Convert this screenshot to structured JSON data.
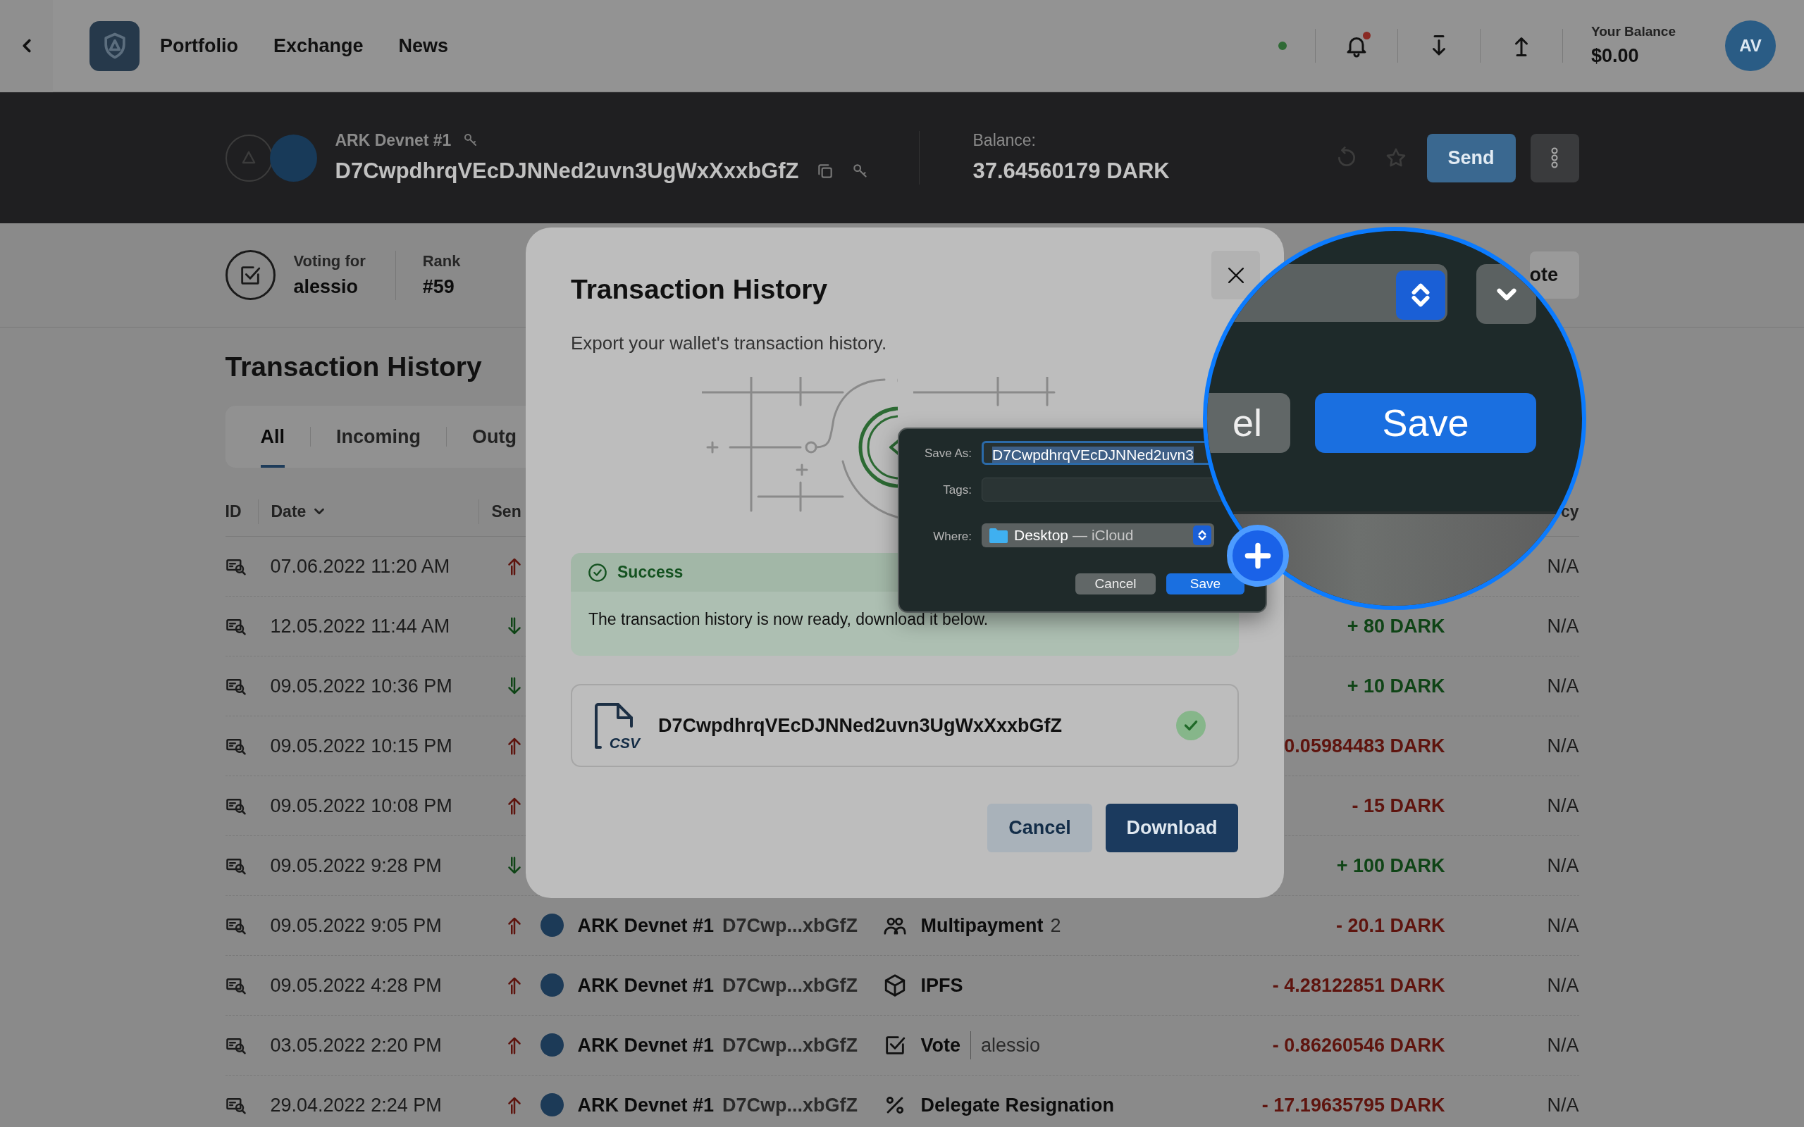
{
  "nav": {
    "links": [
      {
        "label": "Portfolio"
      },
      {
        "label": "Exchange"
      },
      {
        "label": "News"
      }
    ],
    "connected": true,
    "unread_notifications": true,
    "balance_label": "Your Balance",
    "balance": "$0.00",
    "avatar": "AV"
  },
  "wallet": {
    "name": "ARK Devnet #1",
    "address": "D7CwpdhrqVEcDJNNed2uvn3UgWxXxxbGfZ",
    "balance_label": "Balance:",
    "balance": "37.64560179 DARK",
    "send": "Send"
  },
  "voting": {
    "label": "Voting for",
    "delegate": "alessio",
    "rank_label": "Rank",
    "rank": "#59",
    "vote_button": "ote"
  },
  "history": {
    "title": "Transaction History",
    "tabs": [
      {
        "label": "All",
        "selected": true
      },
      {
        "label": "Incoming",
        "selected": false
      },
      {
        "label": "Outg",
        "selected": false
      }
    ],
    "columns": [
      "ID",
      "Date",
      "Sen",
      "cy"
    ],
    "rows": [
      {
        "date": "07.06.2022 11:20 AM",
        "incoming": false,
        "currency": "N/A"
      },
      {
        "date": "12.05.2022 11:44 AM",
        "incoming": true,
        "amount": "+ 80 DARK",
        "currency": "N/A"
      },
      {
        "date": "09.05.2022 10:36 PM",
        "incoming": true,
        "amount": "+ 10 DARK",
        "currency": "N/A"
      },
      {
        "date": "09.05.2022 10:15 PM",
        "incoming": false,
        "amount": "0.05984483 DARK",
        "currency": "N/A"
      },
      {
        "date": "09.05.2022 10:08 PM",
        "incoming": false,
        "amount": "- 15 DARK",
        "currency": "N/A"
      },
      {
        "date": "09.05.2022 9:28 PM",
        "incoming": true,
        "amount": "+ 100 DARK",
        "currency": "N/A"
      },
      {
        "date": "09.05.2022 9:05 PM",
        "incoming": false,
        "sender": "ARK Devnet #1",
        "address": "D7Cwp...xbGfZ",
        "type": {
          "kind": "multipayment",
          "label": "Multipayment",
          "count": "2"
        },
        "amount": "- 20.1 DARK",
        "currency": "N/A"
      },
      {
        "date": "09.05.2022 4:28 PM",
        "incoming": false,
        "sender": "ARK Devnet #1",
        "address": "D7Cwp...xbGfZ",
        "type": {
          "kind": "ipfs",
          "label": "IPFS"
        },
        "amount": "- 4.28122851 DARK",
        "currency": "N/A"
      },
      {
        "date": "03.05.2022 2:20 PM",
        "incoming": false,
        "sender": "ARK Devnet #1",
        "address": "D7Cwp...xbGfZ",
        "type": {
          "kind": "vote",
          "label": "Vote",
          "detail": "alessio"
        },
        "amount": "- 0.86260546 DARK",
        "currency": "N/A"
      },
      {
        "date": "29.04.2022 2:24 PM",
        "incoming": false,
        "sender": "ARK Devnet #1",
        "address": "D7Cwp...xbGfZ",
        "type": {
          "kind": "resignation",
          "label": "Delegate Resignation"
        },
        "amount": "- 17.19635795 DARK",
        "currency": "N/A"
      }
    ]
  },
  "modal": {
    "title": "Transaction History",
    "subtitle": "Export your wallet's transaction history.",
    "alert_title": "Success",
    "alert_text": "The transaction history is now ready, download it below.",
    "file_type": "CSV",
    "file_name": "D7CwpdhrqVEcDJNNed2uvn3UgWxXxxbGfZ",
    "file_ready": true,
    "cancel": "Cancel",
    "download": "Download"
  },
  "save_dialog": {
    "save_as_label": "Save As:",
    "file_name": "D7CwpdhrqVEcDJNNed2uvn3",
    "text_selected": true,
    "tags_label": "Tags:",
    "where_label": "Where:",
    "location": "Desktop",
    "location_detail": "— iCloud",
    "cancel": "Cancel",
    "save": "Save"
  },
  "magnifier": {
    "cancel_fragment": "el",
    "save": "Save"
  }
}
